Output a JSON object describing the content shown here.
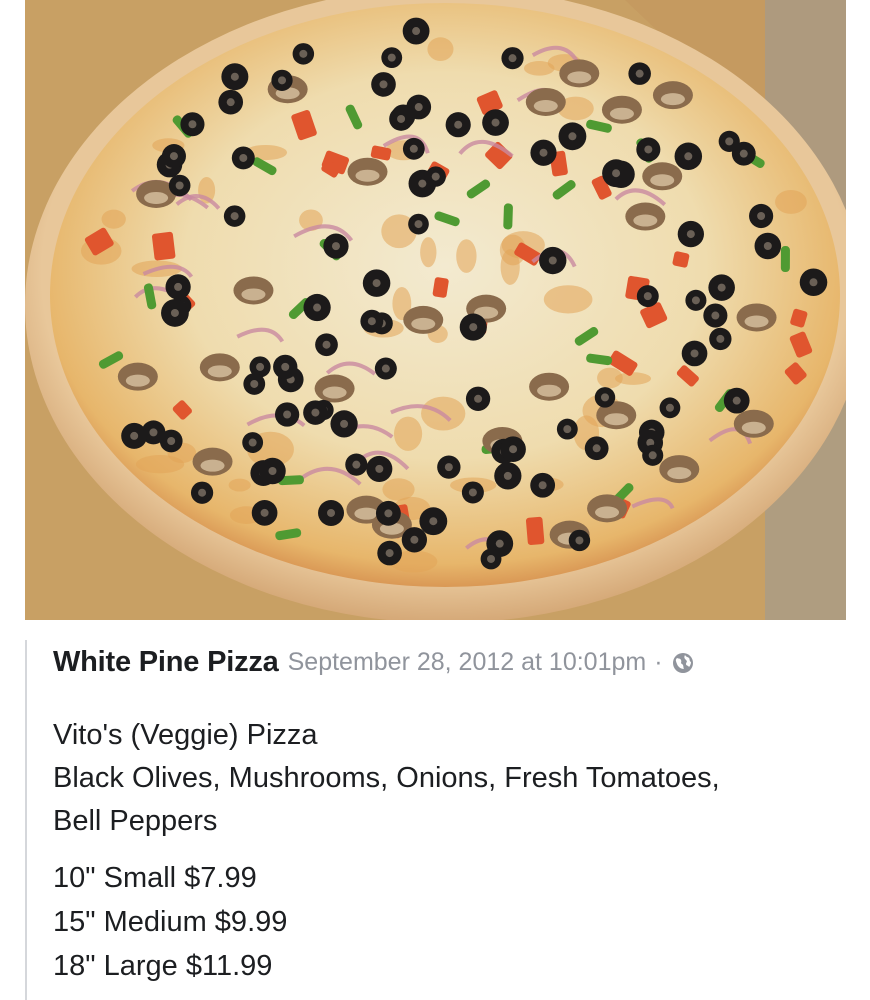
{
  "photo": {
    "icon": "pizza-photo"
  },
  "post": {
    "author": "White Pine Pizza",
    "timestamp": "September 28, 2012 at 10:01pm",
    "separator": "·",
    "audience_icon": "globe-icon",
    "title": "Vito's (Veggie) Pizza",
    "toppings_line1": "Black Olives, Mushrooms, Onions, Fresh Tomatoes,",
    "toppings_line2": "Bell Peppers",
    "prices": [
      "10\" Small $7.99",
      "15\" Medium $9.99",
      "18\" Large $11.99"
    ]
  },
  "colors": {
    "author_text": "#1c1e21",
    "meta_text": "#90949c",
    "divider": "#d5d7db"
  }
}
